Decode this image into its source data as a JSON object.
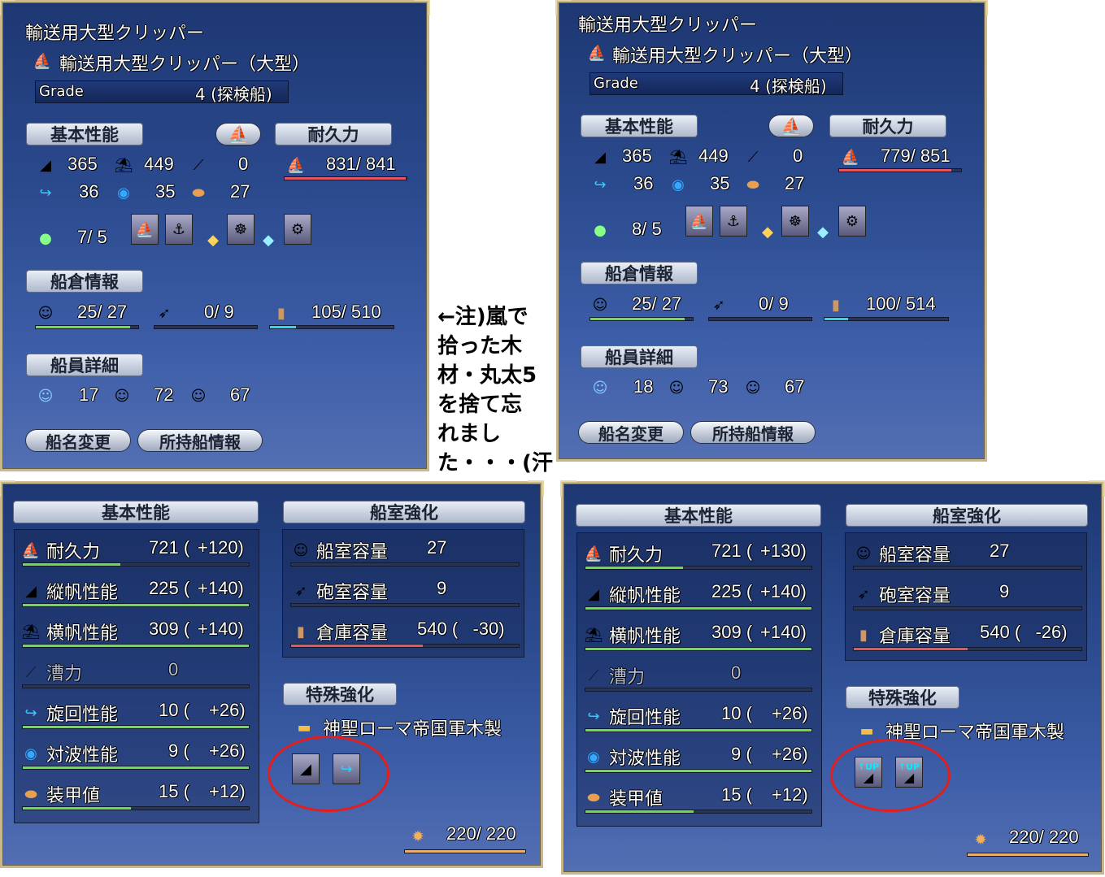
{
  "note_lines": [
    "←注)嵐で",
    "拾った木",
    "材・丸太5",
    "を捨て忘",
    "れまし",
    "た・・・(汗"
  ],
  "top_left": {
    "ship_class": "輸送用大型クリッパー",
    "ship_name": "輸送用大型クリッパー（大型）",
    "grade_label": "Grade",
    "grade_value": "4 (探検船)",
    "sec_basic": "基本性能",
    "sec_dur": "耐久力",
    "v_sail_v": "365",
    "v_sail_h": "449",
    "v_row": "0",
    "v_turn": "36",
    "v_wave": "35",
    "v_armor": "27",
    "durability": "831/ 841",
    "skill": "7/ 5",
    "sec_hold": "船倉情報",
    "crew": "25/ 27",
    "cannon": "0/ 9",
    "cargo": "105/ 510",
    "sec_crew": "船員詳細",
    "c1": "17",
    "c2": "72",
    "c3": "67",
    "btn_rename": "船名変更",
    "btn_info": "所持船情報"
  },
  "top_right": {
    "ship_class": "輸送用大型クリッパー",
    "ship_name": "輸送用大型クリッパー（大型）",
    "grade_label": "Grade",
    "grade_value": "4 (探検船)",
    "sec_basic": "基本性能",
    "sec_dur": "耐久力",
    "v_sail_v": "365",
    "v_sail_h": "449",
    "v_row": "0",
    "v_turn": "36",
    "v_wave": "35",
    "v_armor": "27",
    "durability": "779/ 851",
    "skill": "8/ 5",
    "sec_hold": "船倉情報",
    "crew": "25/ 27",
    "cannon": "0/ 9",
    "cargo": "100/ 514",
    "sec_crew": "船員詳細",
    "c1": "18",
    "c2": "73",
    "c3": "67",
    "btn_rename": "船名変更",
    "btn_info": "所持船情報"
  },
  "bottom_left": {
    "sec_basic": "基本性能",
    "sec_cabin": "船室強化",
    "sec_special": "特殊強化",
    "rows": [
      {
        "label": "耐久力",
        "value": "721 (",
        "bonus": "+120)"
      },
      {
        "label": "縦帆性能",
        "value": "225 (",
        "bonus": "+140)"
      },
      {
        "label": "横帆性能",
        "value": "309 (",
        "bonus": "+140)"
      },
      {
        "label": "漕力",
        "value": "0",
        "bonus": ""
      },
      {
        "label": "旋回性能",
        "value": "10 (",
        "bonus": "+26)"
      },
      {
        "label": "対波性能",
        "value": "9 (",
        "bonus": "+26)"
      },
      {
        "label": "装甲値",
        "value": "15 (",
        "bonus": "+12)"
      }
    ],
    "cabin": [
      {
        "label": "船室容量",
        "value": "27"
      },
      {
        "label": "砲室容量",
        "value": "9"
      },
      {
        "label": "倉庫容量",
        "value": "540 (   -30)"
      }
    ],
    "special_name": "神聖ローマ帝国軍木製",
    "points": "220/ 220"
  },
  "bottom_right": {
    "sec_basic": "基本性能",
    "sec_cabin": "船室強化",
    "sec_special": "特殊強化",
    "rows": [
      {
        "label": "耐久力",
        "value": "721 (",
        "bonus": "+130)"
      },
      {
        "label": "縦帆性能",
        "value": "225 (",
        "bonus": "+140)"
      },
      {
        "label": "横帆性能",
        "value": "309 (",
        "bonus": "+140)"
      },
      {
        "label": "漕力",
        "value": "0",
        "bonus": ""
      },
      {
        "label": "旋回性能",
        "value": "10 (",
        "bonus": "+26)"
      },
      {
        "label": "対波性能",
        "value": "9 (",
        "bonus": "+26)"
      },
      {
        "label": "装甲値",
        "value": "15 (",
        "bonus": "+12)"
      }
    ],
    "cabin": [
      {
        "label": "船室容量",
        "value": "27"
      },
      {
        "label": "砲室容量",
        "value": "9"
      },
      {
        "label": "倉庫容量",
        "value": "540 (   -26)"
      }
    ],
    "special_name": "神聖ローマ帝国軍木製",
    "points": "220/ 220",
    "up_labels": [
      "↑UP",
      "↑UP"
    ]
  },
  "colors": {
    "bar_green": "#6fdc4f",
    "bar_red": "#e4575f",
    "bar_cyan": "#33d6e8",
    "bar_orange": "#eab06c",
    "circle": "#e41d1d"
  },
  "icons": [
    "ship-icon",
    "triangle-sail-icon",
    "square-sail-icon",
    "oar-icon",
    "turn-arrow-icon",
    "wave-icon",
    "armor-icon",
    "medal-icon",
    "sailor-icon",
    "cannon-icon",
    "barrel-icon",
    "gear-icon",
    "wood-icon"
  ]
}
